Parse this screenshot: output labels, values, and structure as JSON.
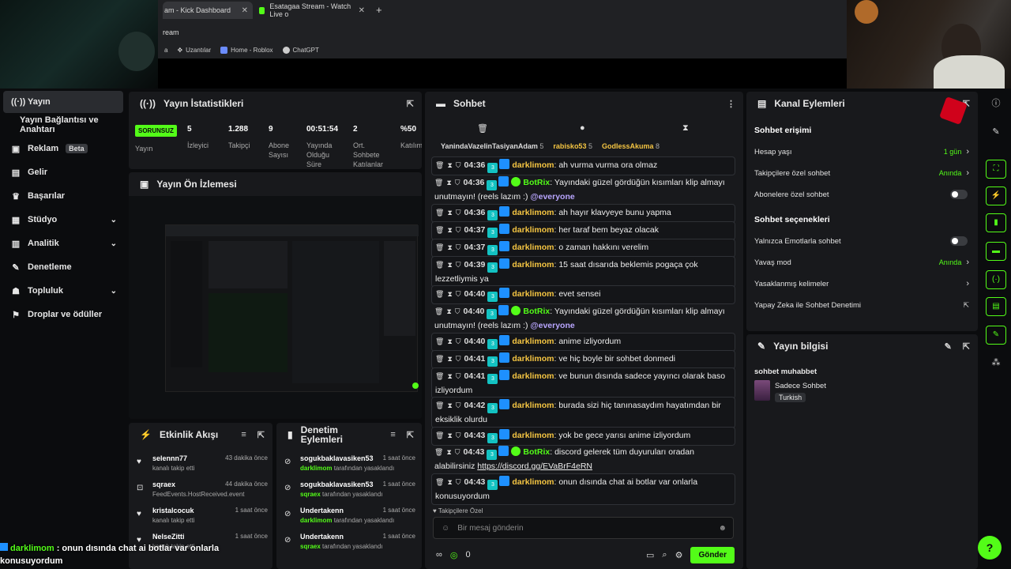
{
  "browser": {
    "tabs": [
      {
        "title": "am - Kick Dashboard"
      },
      {
        "title": "Esatagaa Stream - Watch Live o"
      }
    ],
    "address": "ream",
    "bookmarks": [
      "Uzantılar",
      "Home - Roblox",
      "ChatGPT"
    ],
    "bookmark_prefix": "a"
  },
  "sidebar": {
    "items": [
      {
        "label": "Yayın",
        "icon": "broadcast-icon"
      },
      {
        "label": "Yayın Bağlantısı ve Anahtarı"
      },
      {
        "label": "Reklam",
        "badge": "Beta",
        "icon": "ad-icon"
      },
      {
        "label": "Gelir",
        "icon": "chart-icon"
      },
      {
        "label": "Başarılar",
        "icon": "trophy-icon"
      },
      {
        "label": "Stüdyo",
        "icon": "studio-icon"
      },
      {
        "label": "Analitik",
        "icon": "analytics-icon"
      },
      {
        "label": "Denetleme",
        "icon": "wrench-icon"
      },
      {
        "label": "Topluluk",
        "icon": "community-icon"
      },
      {
        "label": "Droplar ve ödüller",
        "icon": "gift-icon"
      }
    ]
  },
  "stats": {
    "title": "Yayın İstatistikleri",
    "status_badge": "SORUNSUZ",
    "status_label": "Yayın",
    "items": [
      {
        "value": "5",
        "label": "İzleyici"
      },
      {
        "value": "1.288",
        "label": "Takipçi"
      },
      {
        "value": "9",
        "label": "Abone Sayısı"
      },
      {
        "value": "00:51:54",
        "label": "Yayında Olduğu Süre"
      },
      {
        "value": "2",
        "label": "Ort. Sohbete Katılanlar"
      },
      {
        "value": "%50",
        "label": "Katılım"
      }
    ]
  },
  "preview": {
    "title": "Yayın Ön İzlemesi"
  },
  "activity": {
    "title": "Etkinlik Akışı",
    "items": [
      {
        "name": "selennn77",
        "sub": "kanalı takip etti",
        "time": "43 dakika önce"
      },
      {
        "name": "sqraex",
        "sub": "FeedEvents.HostReceived.event",
        "time": "44 dakika önce"
      },
      {
        "name": "kristalcocuk",
        "sub": "kanalı takip etti",
        "time": "1 saat önce"
      },
      {
        "name": "NelseZitti",
        "sub": "kanalı takip etti",
        "time": "1 saat önce"
      }
    ]
  },
  "moderation": {
    "title": "Denetim Eylemleri",
    "items": [
      {
        "name": "sogukbaklavasiken53",
        "mod": "darklimom",
        "sub": "tarafından yasaklandı",
        "time": "1 saat önce"
      },
      {
        "name": "sogukbaklavasiken53",
        "mod": "sqraex",
        "sub": "tarafından yasaklandı",
        "time": "1 saat önce"
      },
      {
        "name": "Undertakenn",
        "mod": "darklimom",
        "sub": "tarafından yasaklandı",
        "time": "1 saat önce"
      },
      {
        "name": "Undertakenn",
        "mod": "sqraex",
        "sub": "tarafından yasaklandı",
        "time": "1 saat önce"
      }
    ]
  },
  "chat": {
    "title": "Sohbet",
    "pinned": [
      {
        "name": "YanindaVazelinTasiyanAdam",
        "count": "5"
      },
      {
        "name": "rabisko53",
        "count": "5"
      },
      {
        "name": "GodlessAkuma",
        "count": "8"
      }
    ],
    "messages": [
      {
        "time": "04:36",
        "user": "darklimom",
        "text": "ah vurma vurma ora olmaz"
      },
      {
        "time": "04:36",
        "user": "BotRix",
        "text": "Yayındaki güzel gördüğün kısımları klip almayı unutmayın! (reels lazım :) ",
        "mention": "@everyone"
      },
      {
        "time": "04:36",
        "user": "darklimom",
        "text": "ah hayır klavyeye bunu yapma"
      },
      {
        "time": "04:37",
        "user": "darklimom",
        "text": "her taraf bem beyaz olacak"
      },
      {
        "time": "04:37",
        "user": "darklimom",
        "text": "o zaman hakkını verelim"
      },
      {
        "time": "04:39",
        "user": "darklimom",
        "text": "15 saat dısarıda beklemis pogaça çok lezzetliymis ya"
      },
      {
        "time": "04:40",
        "user": "darklimom",
        "text": "evet sensei"
      },
      {
        "time": "04:40",
        "user": "BotRix",
        "text": "Yayındaki güzel gördüğün kısımları klip almayı unutmayın! (reels lazım :) ",
        "mention": "@everyone"
      },
      {
        "time": "04:40",
        "user": "darklimom",
        "text": "anime izliyordum"
      },
      {
        "time": "04:41",
        "user": "darklimom",
        "text": "ve hiç boyle bir sohbet donmedi"
      },
      {
        "time": "04:41",
        "user": "darklimom",
        "text": "ve bunun dısında sadece yayıncı olarak baso izliyordum"
      },
      {
        "time": "04:42",
        "user": "darklimom",
        "text": "burada sizi hiç tanınasaydım hayatımdan bir eksiklik olurdu"
      },
      {
        "time": "04:43",
        "user": "darklimom",
        "text": "yok be gece yarısı anime izliyordum"
      },
      {
        "time": "04:43",
        "user": "BotRix",
        "text": "discord gelerek tüm duyuruları oradan alabilirsiniz ",
        "link": "https://discord.gg/EVaBrF4eRN"
      },
      {
        "time": "04:43",
        "user": "darklimom",
        "text": "onun dısında chat ai botlar var onlarla konusuyordum"
      }
    ],
    "follow_only": "Takipçilere Özel",
    "input_placeholder": "Bir mesaj gönderin",
    "points": "0",
    "send_label": "Gönder"
  },
  "channel": {
    "title": "Kanal Eylemleri",
    "access_title": "Sohbet erişimi",
    "account_age": {
      "label": "Hesap yaşı",
      "value": "1 gün"
    },
    "followers_only": {
      "label": "Takipçilere özel sohbet",
      "value": "Anında"
    },
    "subs_only": {
      "label": "Abonelere özel sohbet"
    },
    "options_title": "Sohbet seçenekleri",
    "emotes_only": {
      "label": "Yalnızca Emotlarla sohbet"
    },
    "slow_mode": {
      "label": "Yavaş mod",
      "value": "Anında"
    },
    "banned_words": {
      "label": "Yasaklanmış kelimeler"
    },
    "ai_mod": {
      "label": "Yapay Zeka ile Sohbet Denetimi"
    }
  },
  "info": {
    "title": "Yayın bilgisi",
    "stream_title": "sohbet muhabbet",
    "category": "Sadece Sohbet",
    "language": "Turkish"
  },
  "overlay": {
    "user": "darklimom",
    "text": ": onun dısında chat ai botlar var onlarla konusuyordum"
  },
  "colors": {
    "accent": "#53fc18",
    "background": "#0b0c0e",
    "panel": "#18191c"
  }
}
